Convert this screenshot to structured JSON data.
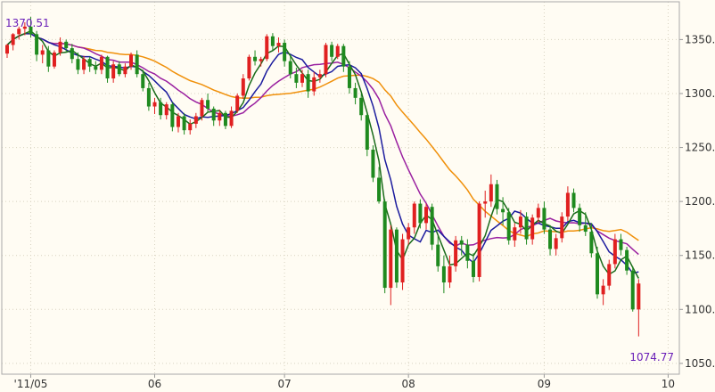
{
  "chart_data": {
    "type": "candlestick",
    "title": "",
    "xlabel": "",
    "ylabel": "",
    "ylim": [
      1040,
      1385
    ],
    "y_ticks": [
      1050,
      1100,
      1150,
      1200,
      1250,
      1300,
      1350
    ],
    "y_tick_labels": [
      "1050.",
      "1100.",
      "1150.",
      "1200.",
      "1250.",
      "1300.",
      "1350."
    ],
    "x_ticks": [
      {
        "label": "'11/05",
        "index": 4
      },
      {
        "label": "06",
        "index": 25
      },
      {
        "label": "07",
        "index": 47
      },
      {
        "label": "08",
        "index": 68
      },
      {
        "label": "09",
        "index": 91
      },
      {
        "label": "10",
        "index": 112
      }
    ],
    "grid": true,
    "legend": "none",
    "highlights": {
      "high_label": "1370.51",
      "high_index": 4,
      "low_label": "1074.77",
      "low_index": 113
    },
    "colors": {
      "up": "#e02020",
      "down": "#1f8a1f",
      "ma_short": "#1a6b1a",
      "ma_medium": "#1c1c9e",
      "ma_long": "#9a20a0",
      "ma_longest": "#f0900a",
      "grid": "#d8d2c0",
      "label": "#6a1fb8"
    },
    "candles": [
      [
        1337,
        1346,
        1333,
        1345
      ],
      [
        1345,
        1356,
        1340,
        1355
      ],
      [
        1355,
        1362,
        1350,
        1360
      ],
      [
        1360,
        1366,
        1354,
        1362
      ],
      [
        1362,
        1371,
        1352,
        1355
      ],
      [
        1355,
        1358,
        1330,
        1336
      ],
      [
        1336,
        1345,
        1328,
        1340
      ],
      [
        1340,
        1344,
        1320,
        1325
      ],
      [
        1325,
        1340,
        1323,
        1338
      ],
      [
        1338,
        1352,
        1335,
        1348
      ],
      [
        1348,
        1350,
        1338,
        1342
      ],
      [
        1342,
        1346,
        1328,
        1332
      ],
      [
        1332,
        1338,
        1318,
        1322
      ],
      [
        1322,
        1335,
        1318,
        1332
      ],
      [
        1332,
        1334,
        1320,
        1325
      ],
      [
        1325,
        1330,
        1318,
        1322
      ],
      [
        1322,
        1336,
        1318,
        1334
      ],
      [
        1334,
        1335,
        1310,
        1314
      ],
      [
        1314,
        1330,
        1310,
        1327
      ],
      [
        1327,
        1330,
        1316,
        1318
      ],
      [
        1318,
        1328,
        1315,
        1325
      ],
      [
        1325,
        1338,
        1322,
        1336
      ],
      [
        1336,
        1340,
        1315,
        1318
      ],
      [
        1318,
        1322,
        1302,
        1305
      ],
      [
        1305,
        1310,
        1284,
        1288
      ],
      [
        1288,
        1296,
        1281,
        1292
      ],
      [
        1292,
        1296,
        1276,
        1280
      ],
      [
        1280,
        1292,
        1276,
        1290
      ],
      [
        1290,
        1292,
        1265,
        1269
      ],
      [
        1269,
        1282,
        1264,
        1279
      ],
      [
        1279,
        1282,
        1262,
        1266
      ],
      [
        1266,
        1276,
        1262,
        1272
      ],
      [
        1272,
        1282,
        1268,
        1279
      ],
      [
        1279,
        1296,
        1275,
        1294
      ],
      [
        1294,
        1300,
        1283,
        1286
      ],
      [
        1286,
        1288,
        1270,
        1275
      ],
      [
        1275,
        1285,
        1270,
        1282
      ],
      [
        1282,
        1284,
        1267,
        1270
      ],
      [
        1270,
        1288,
        1268,
        1284
      ],
      [
        1284,
        1300,
        1282,
        1298
      ],
      [
        1298,
        1318,
        1295,
        1314
      ],
      [
        1314,
        1336,
        1312,
        1334
      ],
      [
        1334,
        1340,
        1326,
        1330
      ],
      [
        1330,
        1334,
        1325,
        1332
      ],
      [
        1332,
        1355,
        1330,
        1353
      ],
      [
        1353,
        1356,
        1340,
        1344
      ],
      [
        1344,
        1352,
        1338,
        1347
      ],
      [
        1347,
        1350,
        1325,
        1330
      ],
      [
        1330,
        1336,
        1314,
        1318
      ],
      [
        1318,
        1324,
        1305,
        1310
      ],
      [
        1310,
        1322,
        1306,
        1318
      ],
      [
        1318,
        1322,
        1296,
        1302
      ],
      [
        1302,
        1320,
        1298,
        1315
      ],
      [
        1315,
        1322,
        1310,
        1318
      ],
      [
        1318,
        1347,
        1315,
        1345
      ],
      [
        1345,
        1348,
        1330,
        1334
      ],
      [
        1334,
        1346,
        1332,
        1344
      ],
      [
        1344,
        1346,
        1320,
        1325
      ],
      [
        1325,
        1330,
        1300,
        1305
      ],
      [
        1305,
        1310,
        1290,
        1296
      ],
      [
        1296,
        1300,
        1275,
        1280
      ],
      [
        1280,
        1282,
        1242,
        1248
      ],
      [
        1248,
        1252,
        1218,
        1222
      ],
      [
        1222,
        1232,
        1198,
        1200
      ],
      [
        1200,
        1202,
        1115,
        1120
      ],
      [
        1120,
        1178,
        1104,
        1174
      ],
      [
        1174,
        1176,
        1120,
        1125
      ],
      [
        1125,
        1170,
        1118,
        1165
      ],
      [
        1165,
        1180,
        1160,
        1176
      ],
      [
        1176,
        1200,
        1170,
        1198
      ],
      [
        1198,
        1202,
        1175,
        1180
      ],
      [
        1180,
        1198,
        1174,
        1195
      ],
      [
        1195,
        1198,
        1155,
        1160
      ],
      [
        1160,
        1168,
        1135,
        1140
      ],
      [
        1140,
        1150,
        1115,
        1125
      ],
      [
        1125,
        1150,
        1120,
        1140
      ],
      [
        1140,
        1168,
        1135,
        1164
      ],
      [
        1164,
        1168,
        1150,
        1160
      ],
      [
        1160,
        1165,
        1138,
        1145
      ],
      [
        1145,
        1152,
        1125,
        1130
      ],
      [
        1130,
        1200,
        1126,
        1198
      ],
      [
        1198,
        1210,
        1185,
        1200
      ],
      [
        1200,
        1225,
        1195,
        1216
      ],
      [
        1216,
        1220,
        1188,
        1193
      ],
      [
        1193,
        1204,
        1178,
        1190
      ],
      [
        1190,
        1194,
        1160,
        1164
      ],
      [
        1164,
        1180,
        1158,
        1176
      ],
      [
        1176,
        1192,
        1170,
        1186
      ],
      [
        1186,
        1190,
        1160,
        1165
      ],
      [
        1165,
        1188,
        1160,
        1185
      ],
      [
        1185,
        1198,
        1180,
        1194
      ],
      [
        1194,
        1200,
        1170,
        1174
      ],
      [
        1174,
        1178,
        1150,
        1156
      ],
      [
        1156,
        1170,
        1150,
        1166
      ],
      [
        1166,
        1190,
        1162,
        1186
      ],
      [
        1186,
        1214,
        1182,
        1208
      ],
      [
        1208,
        1212,
        1190,
        1194
      ],
      [
        1194,
        1198,
        1172,
        1178
      ],
      [
        1178,
        1190,
        1168,
        1172
      ],
      [
        1172,
        1180,
        1148,
        1152
      ],
      [
        1152,
        1158,
        1110,
        1114
      ],
      [
        1114,
        1128,
        1104,
        1122
      ],
      [
        1122,
        1146,
        1118,
        1142
      ],
      [
        1142,
        1170,
        1138,
        1165
      ],
      [
        1165,
        1170,
        1150,
        1155
      ],
      [
        1155,
        1158,
        1132,
        1136
      ],
      [
        1136,
        1140,
        1098,
        1100
      ],
      [
        1100,
        1128,
        1075,
        1124
      ]
    ]
  }
}
